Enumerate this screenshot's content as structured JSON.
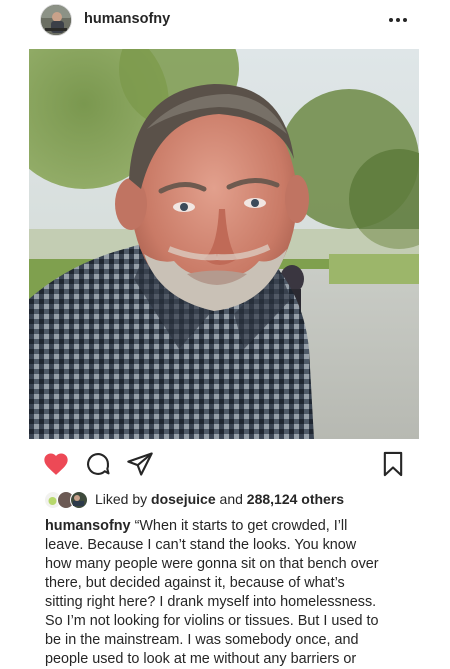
{
  "post": {
    "username": "humansofny",
    "avatar_icon": "profile-avatar",
    "more_icon": "more-options-icon"
  },
  "photo": {
    "subject": "portrait-of-man-with-grey-stubble-in-checked-shirt"
  },
  "actions": {
    "liked": true,
    "like_color": "#ed4956",
    "icons": [
      "heart-icon",
      "comment-icon",
      "share-icon",
      "bookmark-icon"
    ]
  },
  "likes": {
    "prefix": "Liked by ",
    "liker": "dosejuice",
    "middle": " and ",
    "count": "288,124 others"
  },
  "caption": {
    "username": "humansofny",
    "lines": [
      "“When it starts to get crowded, I’ll",
      "leave.  Because I can’t stand the looks.  You know",
      "how many people were gonna sit on that bench over",
      "there, but decided against it, because of what’s",
      "sitting right here?  I drank myself into homelessness.",
      "So I’m not looking for violins or tissues.  But I used to",
      "be in the mainstream.  I was somebody once, and",
      "people used to look at me without any barriers or"
    ]
  }
}
